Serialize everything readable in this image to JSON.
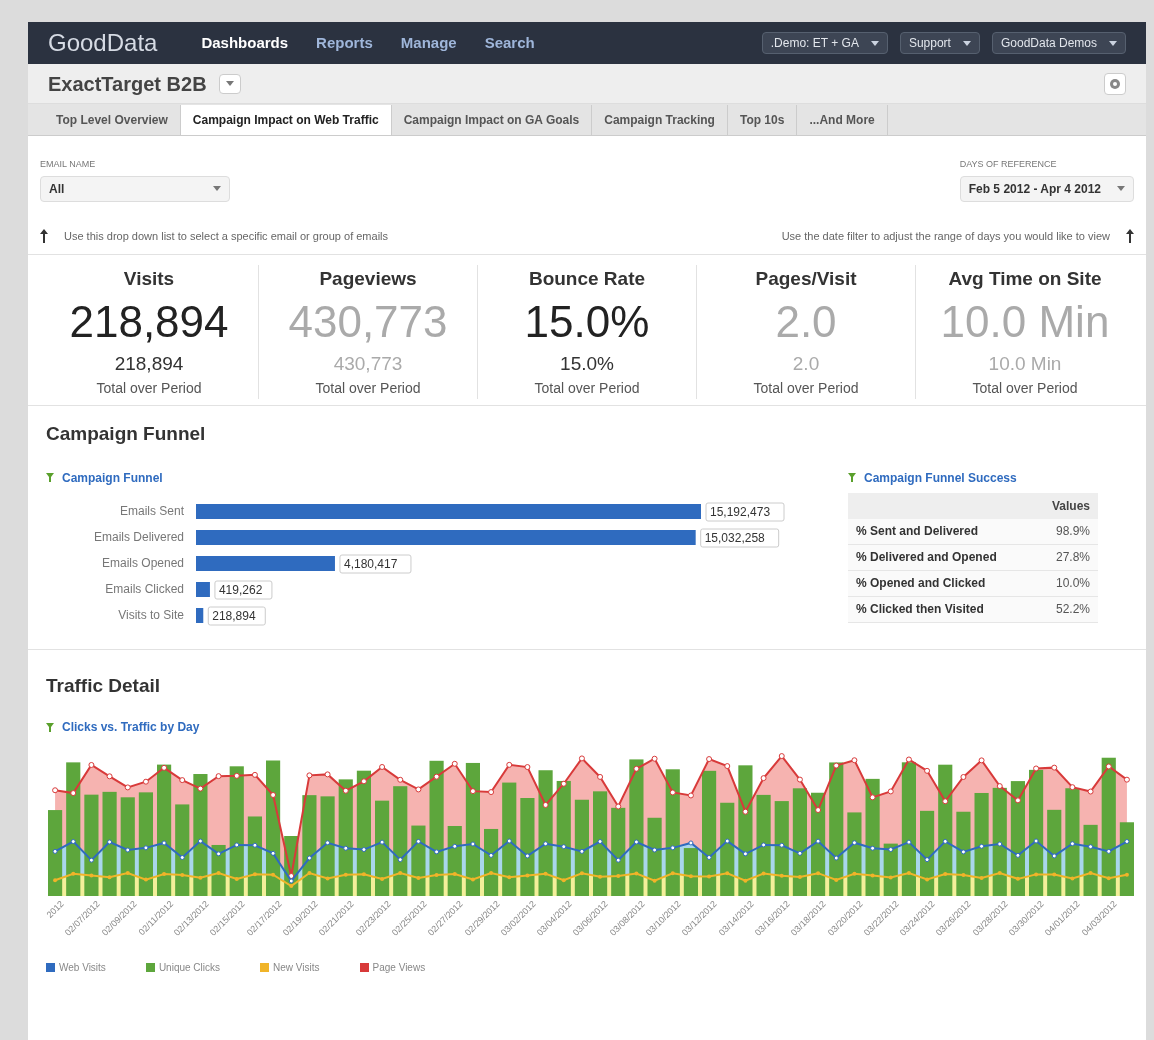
{
  "topbar": {
    "logo": "GoodData",
    "nav": [
      {
        "label": "Dashboards",
        "selected": true
      },
      {
        "label": "Reports",
        "selected": false
      },
      {
        "label": "Manage",
        "selected": false
      },
      {
        "label": "Search",
        "selected": false
      }
    ],
    "menus": [
      ".Demo: ET + GA",
      "Support",
      "GoodData Demos"
    ]
  },
  "project": {
    "title": "ExactTarget B2B"
  },
  "tabs": [
    {
      "label": "Top Level Overview",
      "selected": false
    },
    {
      "label": "Campaign Impact on Web Traffic",
      "selected": true
    },
    {
      "label": "Campaign Impact on GA Goals",
      "selected": false
    },
    {
      "label": "Campaign Tracking",
      "selected": false
    },
    {
      "label": "Top 10s",
      "selected": false
    },
    {
      "label": "...And More",
      "selected": false
    }
  ],
  "filters": [
    {
      "label": "EMAIL NAME",
      "value": "All"
    },
    {
      "label": "DAYS OF REFERENCE",
      "value": "Feb 5 2012 - Apr 4 2012"
    }
  ],
  "hints": [
    "Use this drop down list to select a specific email or group of emails",
    "Use the date filter to adjust the range of days you would like to view"
  ],
  "kpis": [
    {
      "title": "Visits",
      "value": "218,894",
      "total": "218,894",
      "caption": "Total over Period",
      "muted": false
    },
    {
      "title": "Pageviews",
      "value": "430,773",
      "total": "430,773",
      "caption": "Total over Period",
      "muted": true
    },
    {
      "title": "Bounce Rate",
      "value": "15.0%",
      "total": "15.0%",
      "caption": "Total over Period",
      "muted": false
    },
    {
      "title": "Pages/Visit",
      "value": "2.0",
      "total": "2.0",
      "caption": "Total over Period",
      "muted": true
    },
    {
      "title": "Avg Time on Site",
      "value": "10.0 Min",
      "total": "10.0 Min",
      "caption": "Total over Period",
      "muted": true
    }
  ],
  "funnel_section": {
    "heading": "Campaign Funnel",
    "report_title": "Campaign Funnel",
    "chart_data": {
      "type": "bar",
      "orientation": "horizontal",
      "categories": [
        "Emails Sent",
        "Emails Delivered",
        "Emails Opened",
        "Emails Clicked",
        "Visits to Site"
      ],
      "values": [
        15192473,
        15032258,
        4180417,
        419262,
        218894
      ],
      "value_labels": [
        "15,192,473",
        "15,032,258",
        "4,180,417",
        "419,262",
        "218,894"
      ],
      "data_labels": true
    },
    "success_table": {
      "title": "Campaign Funnel Success",
      "column": "Values",
      "rows": [
        {
          "label": "% Sent and Delivered",
          "value": "98.9%"
        },
        {
          "label": "% Delivered and Opened",
          "value": "27.8%"
        },
        {
          "label": "% Opened and Clicked",
          "value": "10.0%"
        },
        {
          "label": "% Clicked then Visited",
          "value": "52.2%"
        }
      ]
    }
  },
  "traffic_section": {
    "heading": "Traffic Detail",
    "report_title": "Clicks vs. Traffic by Day",
    "x_labels": [
      "2012",
      "02/07/2012",
      "02/09/2012",
      "02/11/2012",
      "02/13/2012",
      "02/15/2012",
      "02/17/2012",
      "02/19/2012",
      "02/21/2012",
      "02/23/2012",
      "02/25/2012",
      "02/27/2012",
      "02/29/2012",
      "03/02/2012",
      "03/04/2012",
      "03/06/2012",
      "03/08/2012",
      "03/10/2012",
      "03/12/2012",
      "03/14/2012",
      "03/16/2012",
      "03/18/2012",
      "03/20/2012",
      "03/22/2012",
      "03/24/2012",
      "03/26/2012",
      "03/28/2012",
      "03/30/2012",
      "04/01/2012",
      "04/03/2012"
    ],
    "legend": [
      {
        "label": "Web Visits",
        "color": "#2f6bbf"
      },
      {
        "label": "Unique Clicks",
        "color": "#5da63c"
      },
      {
        "label": "New Visits",
        "color": "#f0b429"
      },
      {
        "label": "Page Views",
        "color": "#d83a3a"
      }
    ]
  }
}
